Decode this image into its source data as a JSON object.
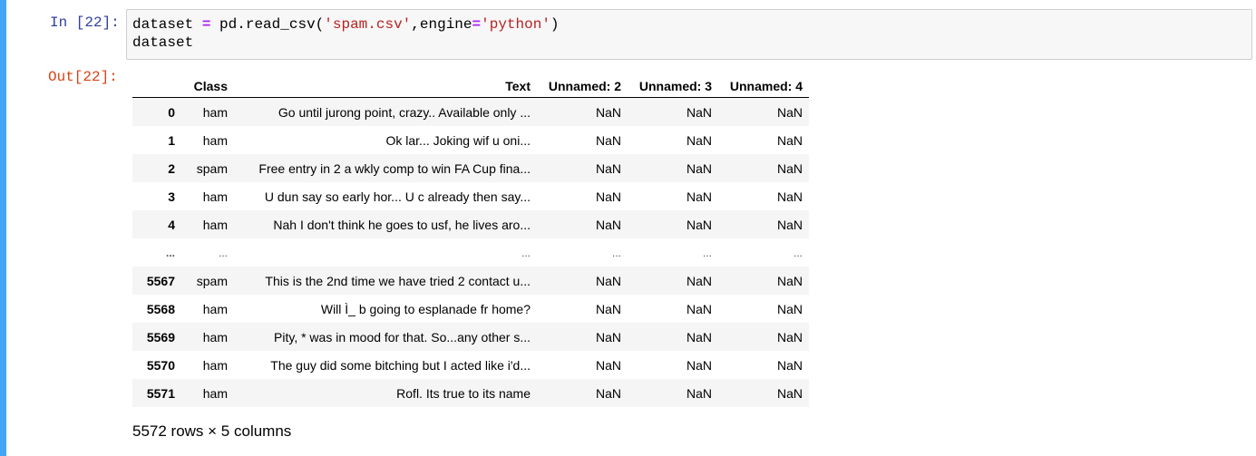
{
  "input_cell": {
    "prompt": "In [22]:",
    "code_line1": {
      "var": "dataset",
      "op": "=",
      "call": "pd.read_csv(",
      "arg1": "'spam.csv'",
      "sep": ",engine",
      "op2": "=",
      "arg2": "'python'",
      "close": ")"
    },
    "code_line2": "dataset"
  },
  "output_cell": {
    "prompt": "Out[22]:",
    "columns": [
      "",
      "Class",
      "Text",
      "Unnamed: 2",
      "Unnamed: 3",
      "Unnamed: 4"
    ],
    "rows": [
      {
        "index": "0",
        "class": "ham",
        "text": "Go until jurong point, crazy.. Available only ...",
        "u2": "NaN",
        "u3": "NaN",
        "u4": "NaN"
      },
      {
        "index": "1",
        "class": "ham",
        "text": "Ok lar... Joking wif u oni...",
        "u2": "NaN",
        "u3": "NaN",
        "u4": "NaN"
      },
      {
        "index": "2",
        "class": "spam",
        "text": "Free entry in 2 a wkly comp to win FA Cup fina...",
        "u2": "NaN",
        "u3": "NaN",
        "u4": "NaN"
      },
      {
        "index": "3",
        "class": "ham",
        "text": "U dun say so early hor... U c already then say...",
        "u2": "NaN",
        "u3": "NaN",
        "u4": "NaN"
      },
      {
        "index": "4",
        "class": "ham",
        "text": "Nah I don't think he goes to usf, he lives aro...",
        "u2": "NaN",
        "u3": "NaN",
        "u4": "NaN"
      },
      {
        "index": "...",
        "class": "...",
        "text": "...",
        "u2": "...",
        "u3": "...",
        "u4": "..."
      },
      {
        "index": "5567",
        "class": "spam",
        "text": "This is the 2nd time we have tried 2 contact u...",
        "u2": "NaN",
        "u3": "NaN",
        "u4": "NaN"
      },
      {
        "index": "5568",
        "class": "ham",
        "text": "Will Ì_ b going to esplanade fr home?",
        "u2": "NaN",
        "u3": "NaN",
        "u4": "NaN"
      },
      {
        "index": "5569",
        "class": "ham",
        "text": "Pity, * was in mood for that. So...any other s...",
        "u2": "NaN",
        "u3": "NaN",
        "u4": "NaN"
      },
      {
        "index": "5570",
        "class": "ham",
        "text": "The guy did some bitching but I acted like i'd...",
        "u2": "NaN",
        "u3": "NaN",
        "u4": "NaN"
      },
      {
        "index": "5571",
        "class": "ham",
        "text": "Rofl. Its true to its name",
        "u2": "NaN",
        "u3": "NaN",
        "u4": "NaN"
      }
    ],
    "shape_info": "5572 rows × 5 columns"
  },
  "colors": {
    "cell_bar": "#42a5f5",
    "in_prompt": "#303f9f",
    "out_prompt": "#d84315",
    "string_token": "#ba2121",
    "operator_token": "#aa22ff"
  }
}
